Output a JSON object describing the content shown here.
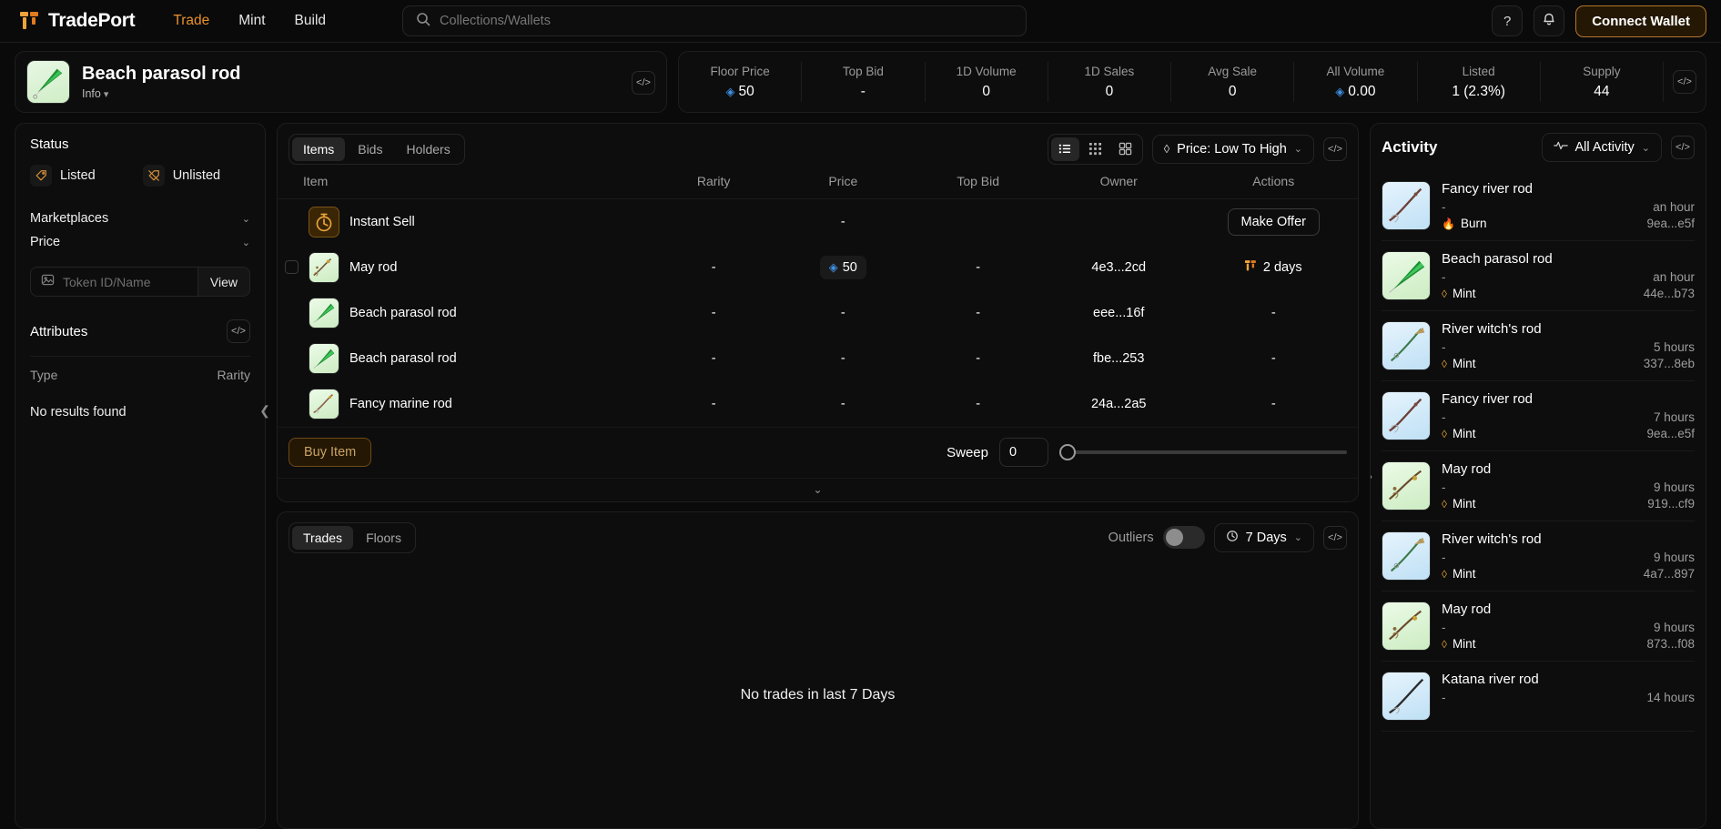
{
  "topnav": {
    "brand": "TradePort",
    "links": [
      {
        "label": "Trade",
        "active": true
      },
      {
        "label": "Mint",
        "active": false
      },
      {
        "label": "Build",
        "active": false
      }
    ],
    "search_placeholder": "Collections/Wallets",
    "help_icon": "?",
    "bell_icon": "bell-icon",
    "connect_label": "Connect Wallet"
  },
  "collection": {
    "title": "Beach parasol rod",
    "info_label": "Info",
    "code_icon": "</>"
  },
  "stats": [
    {
      "label": "Floor Price",
      "value": "50",
      "has_apt": true
    },
    {
      "label": "Top Bid",
      "value": "-",
      "has_apt": false
    },
    {
      "label": "1D Volume",
      "value": "0",
      "has_apt": false
    },
    {
      "label": "1D Sales",
      "value": "0",
      "has_apt": false
    },
    {
      "label": "Avg Sale",
      "value": "0",
      "has_apt": false
    },
    {
      "label": "All Volume",
      "value": "0.00",
      "has_apt": true
    },
    {
      "label": "Listed",
      "value": "1 (2.3%)",
      "has_apt": false
    },
    {
      "label": "Supply",
      "value": "44",
      "has_apt": false
    }
  ],
  "sidebar": {
    "status_title": "Status",
    "status_options": [
      {
        "label": "Listed",
        "icon": "tag-icon"
      },
      {
        "label": "Unlisted",
        "icon": "tag-slash-icon"
      }
    ],
    "marketplaces_label": "Marketplaces",
    "price_label": "Price",
    "token_placeholder": "Token ID/Name",
    "token_value": "",
    "view_label": "View",
    "attributes_title": "Attributes",
    "attr_col_type": "Type",
    "attr_col_rarity": "Rarity",
    "no_results": "No results found"
  },
  "items_panel": {
    "tabs": [
      {
        "label": "Items",
        "active": true
      },
      {
        "label": "Bids",
        "active": false
      },
      {
        "label": "Holders",
        "active": false
      }
    ],
    "view_modes": [
      {
        "name": "list-view",
        "active": true
      },
      {
        "name": "small-grid-view",
        "active": false
      },
      {
        "name": "large-grid-view",
        "active": false
      }
    ],
    "sort_label": "Price: Low To High",
    "columns": [
      "Item",
      "Rarity",
      "Price",
      "Top Bid",
      "Owner",
      "Actions"
    ],
    "rows": [
      {
        "name": "Instant Sell",
        "thumb": "orange",
        "checkbox": false,
        "rarity": "",
        "price": "-",
        "price_chip": false,
        "top_bid": "",
        "owner": "",
        "action": "Make Offer",
        "action_type": "button"
      },
      {
        "name": "May rod",
        "thumb": "green-may",
        "checkbox": true,
        "rarity": "-",
        "price": "50",
        "price_chip": true,
        "top_bid": "-",
        "owner": "4e3...2cd",
        "action": "2 days",
        "action_type": "days"
      },
      {
        "name": "Beach parasol rod",
        "thumb": "green-parasol",
        "checkbox": false,
        "rarity": "-",
        "price": "-",
        "price_chip": false,
        "top_bid": "-",
        "owner": "eee...16f",
        "action": "-",
        "action_type": "text"
      },
      {
        "name": "Beach parasol rod",
        "thumb": "green-parasol",
        "checkbox": false,
        "rarity": "-",
        "price": "-",
        "price_chip": false,
        "top_bid": "-",
        "owner": "fbe...253",
        "action": "-",
        "action_type": "text"
      },
      {
        "name": "Fancy marine rod",
        "thumb": "green-fancy",
        "checkbox": false,
        "rarity": "-",
        "price": "-",
        "price_chip": false,
        "top_bid": "-",
        "owner": "24a...2a5",
        "action": "-",
        "action_type": "text"
      }
    ],
    "buy_label": "Buy Item",
    "sweep_label": "Sweep",
    "sweep_value": "0"
  },
  "trades_panel": {
    "tabs": [
      {
        "label": "Trades",
        "active": true
      },
      {
        "label": "Floors",
        "active": false
      }
    ],
    "outliers_label": "Outliers",
    "range_label": "7 Days",
    "empty_message": "No trades in last 7 Days"
  },
  "activity": {
    "title": "Activity",
    "filter_label": "All Activity",
    "items": [
      {
        "name": "Fancy river rod",
        "price": "-",
        "kind": "Burn",
        "kind_icon": "flame-icon",
        "time": "an hour",
        "hash": "9ea...e5f",
        "thumb": "blue-fancy"
      },
      {
        "name": "Beach parasol rod",
        "price": "-",
        "kind": "Mint",
        "kind_icon": "drop-icon",
        "time": "an hour",
        "hash": "44e...b73",
        "thumb": "green-parasol"
      },
      {
        "name": "River witch's rod",
        "price": "-",
        "kind": "Mint",
        "kind_icon": "drop-icon",
        "time": "5 hours",
        "hash": "337...8eb",
        "thumb": "blue-witch"
      },
      {
        "name": "Fancy river rod",
        "price": "-",
        "kind": "Mint",
        "kind_icon": "drop-icon",
        "time": "7 hours",
        "hash": "9ea...e5f",
        "thumb": "blue-fancy"
      },
      {
        "name": "May rod",
        "price": "-",
        "kind": "Mint",
        "kind_icon": "drop-icon",
        "time": "9 hours",
        "hash": "919...cf9",
        "thumb": "green-may"
      },
      {
        "name": "River witch's rod",
        "price": "-",
        "kind": "Mint",
        "kind_icon": "drop-icon",
        "time": "9 hours",
        "hash": "4a7...897",
        "thumb": "blue-witch"
      },
      {
        "name": "May rod",
        "price": "-",
        "kind": "Mint",
        "kind_icon": "drop-icon",
        "time": "9 hours",
        "hash": "873...f08",
        "thumb": "green-may"
      },
      {
        "name": "Katana river rod",
        "price": "-",
        "kind": "",
        "kind_icon": "drop-icon",
        "time": "14 hours",
        "hash": "",
        "thumb": "blue-katana"
      }
    ]
  },
  "colors": {
    "accent": "#e8912d",
    "apt_blue": "#3f8fe0",
    "burn_orange": "#e08c2a",
    "bg": "#0a0a0a",
    "panel": "#0d0d0d"
  }
}
